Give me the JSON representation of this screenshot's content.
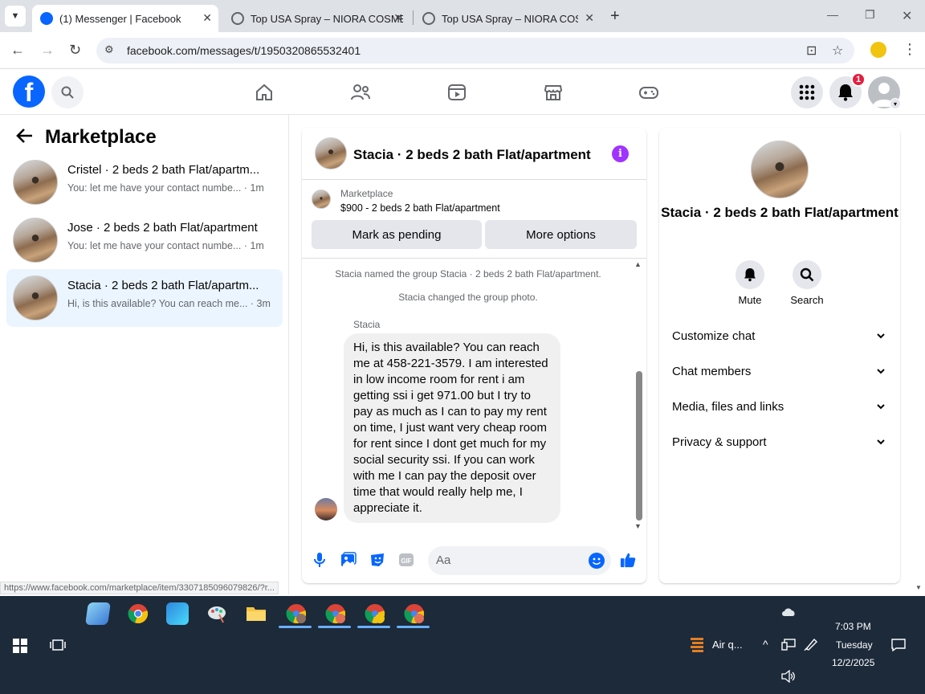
{
  "browser": {
    "tabs": [
      {
        "title": "(1) Messenger | Facebook",
        "active": true
      },
      {
        "title": "Top USA Spray – NIORA COSME",
        "active": false
      },
      {
        "title": "Top USA Spray – NIORA COSME",
        "active": false
      }
    ],
    "url": "facebook.com/messages/t/1950320865532401",
    "status_url": "https://www.facebook.com/marketplace/item/3307185096079826/?r..."
  },
  "header": {
    "notification_count": "1"
  },
  "sidebar": {
    "title": "Marketplace",
    "conversations": [
      {
        "name": "Cristel · 2 beds 2 bath Flat/apartm...",
        "preview": "You: let me have your contact numbe... · 1m"
      },
      {
        "name": "Jose · 2 beds 2 bath Flat/apartment",
        "preview": "You: let me have your contact numbe... · 1m"
      },
      {
        "name": "Stacia · 2 beds 2 bath Flat/apartm...",
        "preview": "Hi, is this available? You can reach me... · 3m"
      }
    ]
  },
  "chat": {
    "title": "Stacia · 2 beds 2 bath Flat/apartment",
    "marketplace_label": "Marketplace",
    "listing": "$900 - 2 beds 2 bath Flat/apartment",
    "mark_pending_label": "Mark as pending",
    "more_options_label": "More options",
    "system_messages": [
      "Stacia named the group Stacia · 2 beds 2 bath Flat/apartment.",
      "Stacia changed the group photo."
    ],
    "sender": "Stacia",
    "message": "Hi, is this available? You can reach me at 458-221-3579. I am interested in low income room for rent i am getting ssi i get 971.00 but I try to pay as much as I can to pay my rent on time, I just want very cheap room for rent since I dont get much for my social security ssi. If you can work with me I can pay the deposit over time that would really help me, I appreciate it.",
    "composer_placeholder": "Aa"
  },
  "details": {
    "name": "Stacia · 2 beds 2 bath Flat/apartment",
    "actions": {
      "mute": "Mute",
      "search": "Search"
    },
    "sections": [
      "Customize chat",
      "Chat members",
      "Media, files and links",
      "Privacy & support"
    ]
  },
  "taskbar": {
    "weather": "Air q...",
    "time": "7:03 PM",
    "day": "Tuesday",
    "date": "12/2/2025"
  },
  "colors": {
    "fb_blue": "#0866ff",
    "active_conv_bg": "#ebf5ff",
    "info_purple": "#a033ff",
    "badge_red": "#e41e3f",
    "taskbar_bg": "#1c2a3a"
  }
}
